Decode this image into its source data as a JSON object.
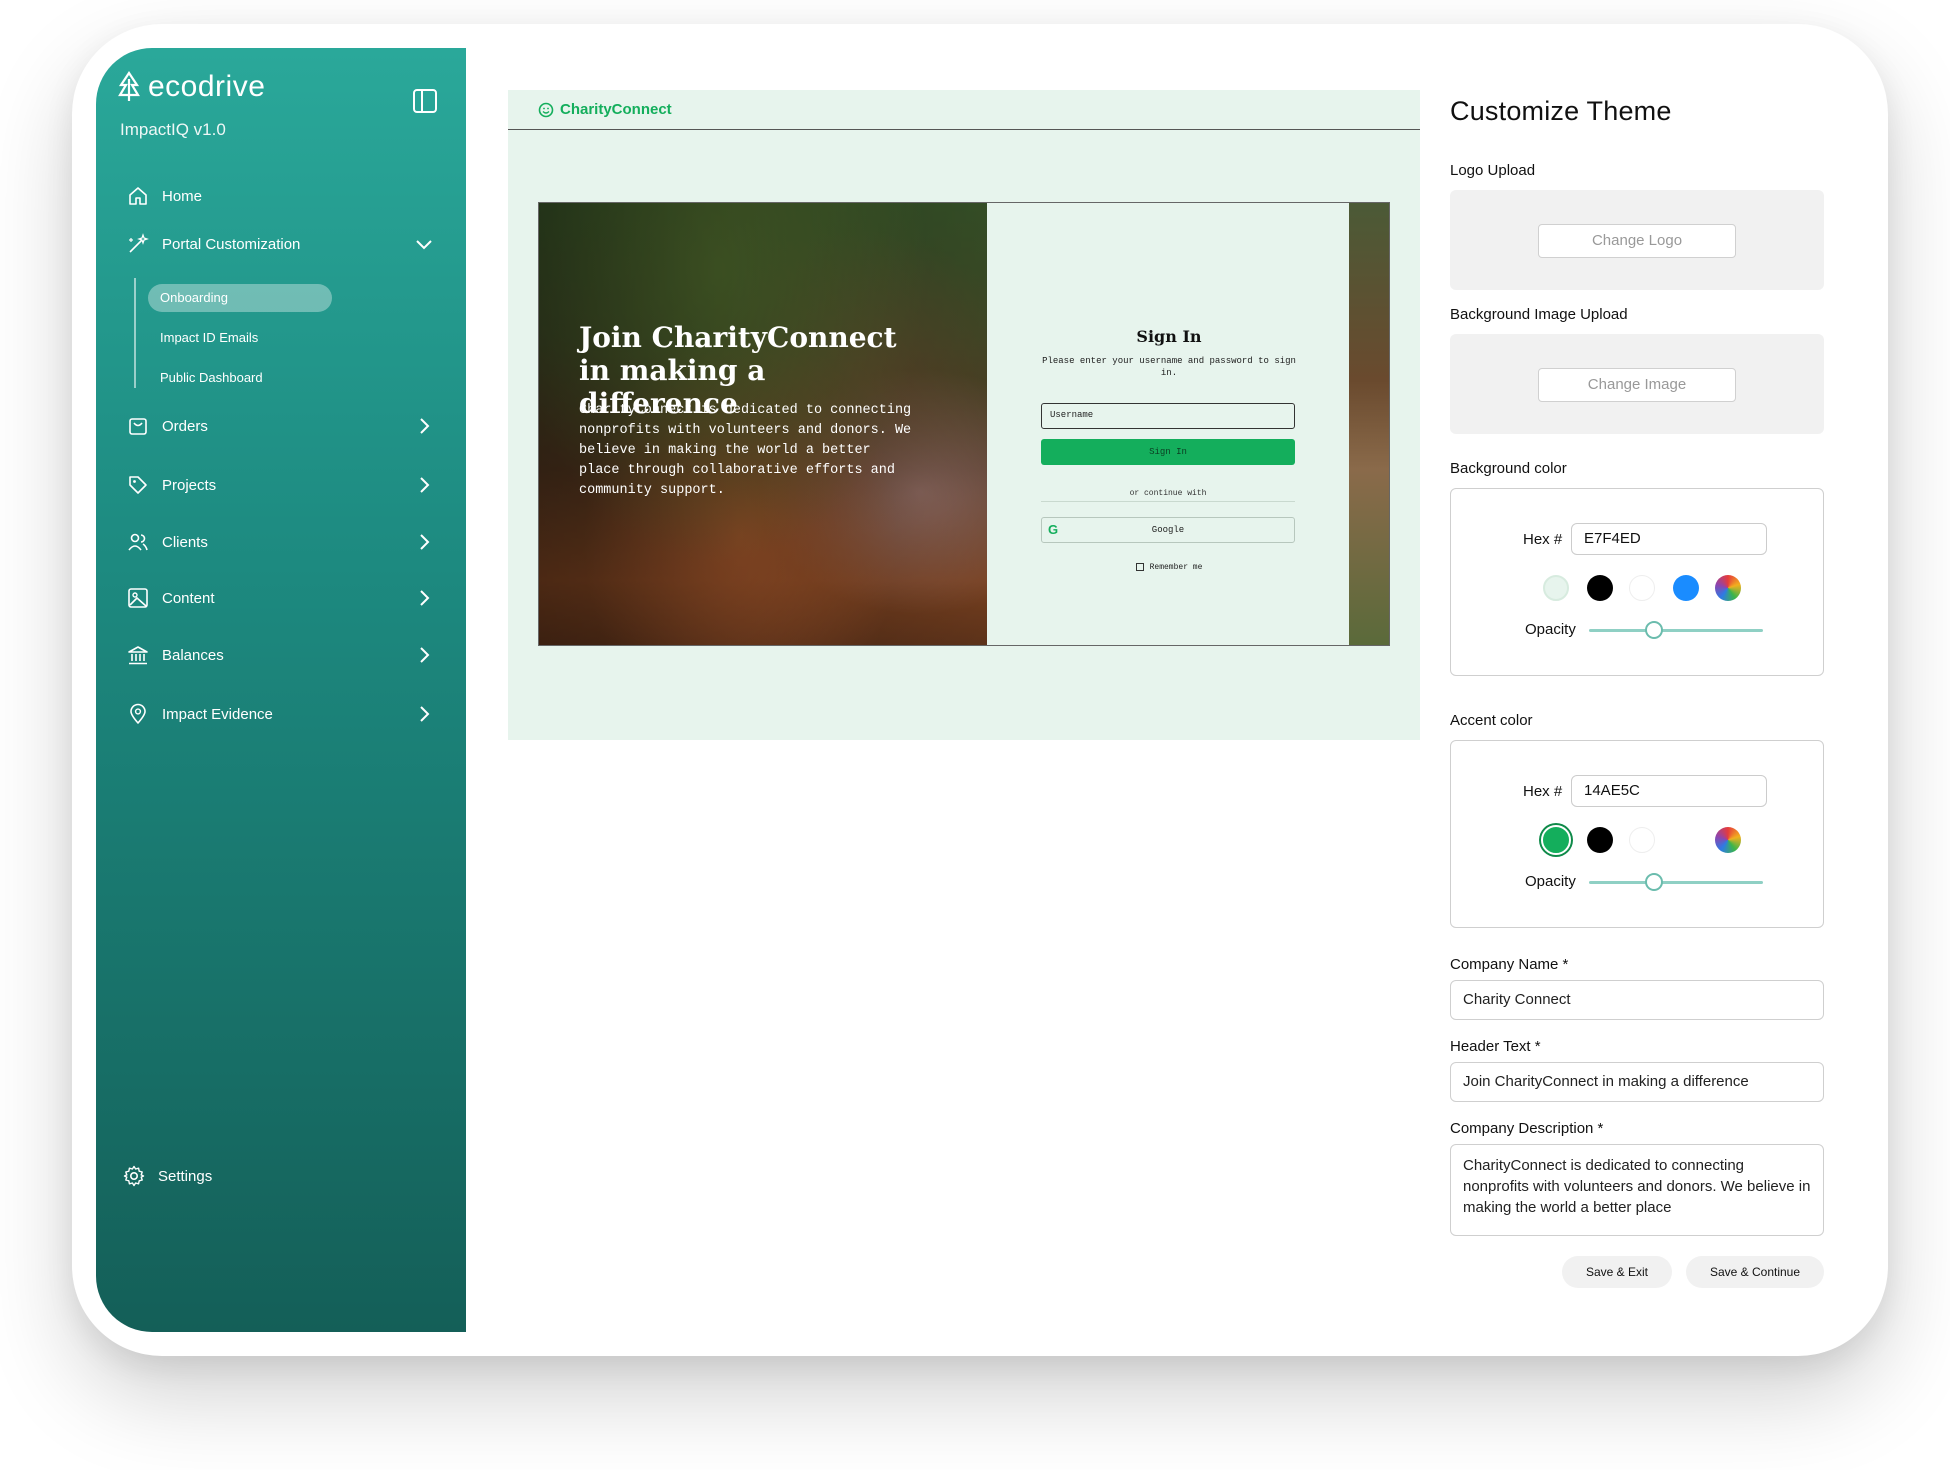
{
  "sidebar": {
    "brand": "ecodrive",
    "version": "ImpactIQ v1.0",
    "items": [
      {
        "label": "Home",
        "icon": "home-icon"
      },
      {
        "label": "Portal Customization",
        "icon": "magic-wand-icon"
      },
      {
        "label": "Orders",
        "icon": "bag-icon"
      },
      {
        "label": "Projects",
        "icon": "tag-icon"
      },
      {
        "label": "Clients",
        "icon": "users-icon"
      },
      {
        "label": "Content",
        "icon": "image-icon"
      },
      {
        "label": "Balances",
        "icon": "bank-icon"
      },
      {
        "label": "Impact Evidence",
        "icon": "location-pin-icon"
      }
    ],
    "subitems": [
      {
        "label": "Onboarding",
        "active": true
      },
      {
        "label": "Impact ID Emails",
        "active": false
      },
      {
        "label": "Public Dashboard",
        "active": false
      }
    ],
    "settings": "Settings"
  },
  "preview": {
    "brand": "CharityConnect",
    "headline": "Join CharityConnect in making a difference",
    "description": "CharityConnect is dedicated to connecting nonprofits with volunteers and donors. We believe in making the world a better place through collaborative efforts and community support.",
    "signin_title": "Sign In",
    "signin_sub": "Please enter your username and password to sign in.",
    "username_placeholder": "Username",
    "signin_button": "Sign In",
    "or_text": "or continue with",
    "google_button": "Google",
    "remember": "Remember me"
  },
  "panel": {
    "title": "Customize Theme",
    "logo_label": "Logo Upload",
    "logo_button": "Change Logo",
    "bg_image_label": "Background Image Upload",
    "bg_image_button": "Change Image",
    "bg_color_label": "Background color",
    "bg_color_hex": "E7F4ED",
    "accent_label": "Accent color",
    "accent_hex": "14AE5C",
    "hex_label": "Hex #",
    "opacity_label": "Opacity",
    "bg_opacity": 0.35,
    "accent_opacity": 0.35,
    "company_name_label": "Company Name *",
    "company_name": "Charity Connect",
    "header_text_label": "Header Text *",
    "header_text": "Join CharityConnect in making a difference",
    "description_label": "Company Description *",
    "description": "CharityConnect is dedicated to connecting nonprofits with volunteers and donors. We believe in making the world a better place",
    "save_exit": "Save & Exit",
    "save_continue": "Save & Continue"
  },
  "colors": {
    "sidebar_top": "#2aa89a",
    "sidebar_bottom": "#145f58",
    "preview_bg": "#e7f4ed",
    "accent": "#14ae5c",
    "swatch_blue": "#1a8cff"
  }
}
